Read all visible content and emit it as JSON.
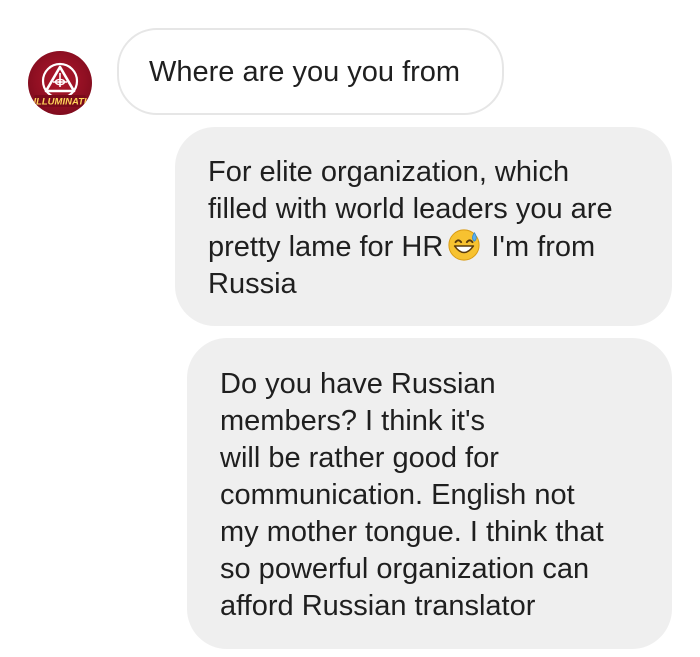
{
  "avatar": {
    "label": "ILLUMINATI",
    "icon": "illuminati-pyramid-eye-icon"
  },
  "messages": [
    {
      "direction": "incoming",
      "lines": [
        "Where are you you from"
      ]
    },
    {
      "direction": "outgoing",
      "lines": [
        "For elite organization, which",
        "filled with world leaders you are",
        "pretty lame for HR",
        "I'm from",
        "Russia"
      ],
      "emoji": "grinning-face-with-sweat-emoji"
    },
    {
      "direction": "outgoing",
      "lines": [
        "Do you have Russian",
        "members? I think it's",
        "will be rather good for",
        "communication. English not",
        "my mother tongue. I think that",
        "so powerful organization can",
        "afford Russian translator"
      ]
    }
  ],
  "colors": {
    "incoming_bubble": "#ffffff",
    "incoming_border": "#e6e6e6",
    "outgoing_bubble": "#efefef",
    "avatar": "#a3142a"
  }
}
